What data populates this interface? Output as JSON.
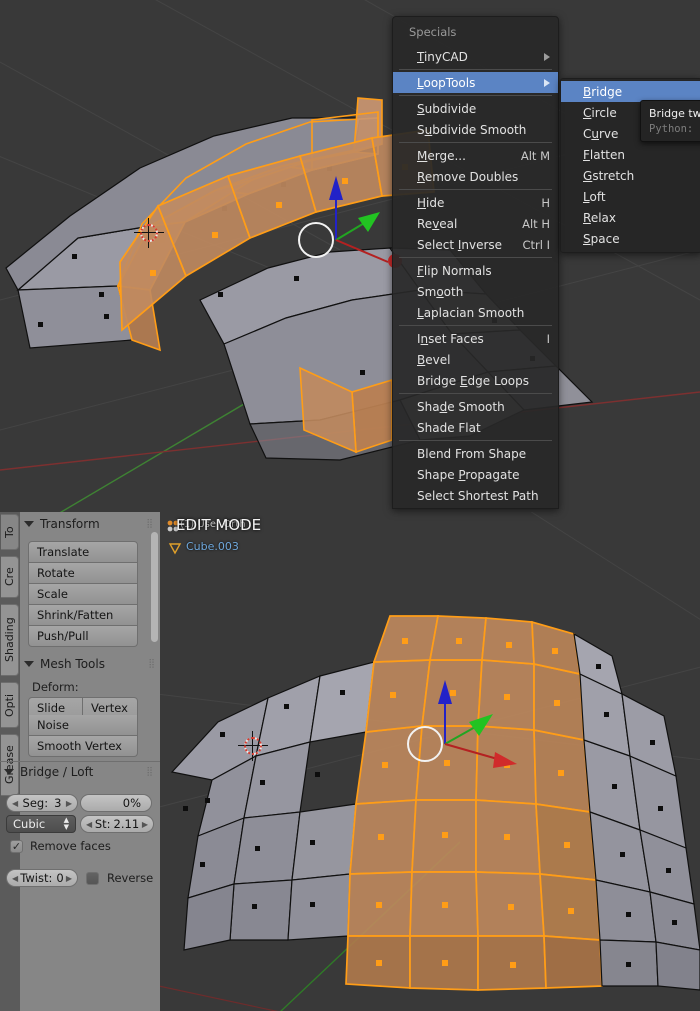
{
  "app": "Blender",
  "viewports": {
    "top": {
      "background": "#393939"
    },
    "bottom": {
      "background": "#393939",
      "view_info": "(1) User Orth",
      "mode_label": "EDIT MODE",
      "object_name": "Cube.003"
    }
  },
  "colors": {
    "viewport_bg": "#393939",
    "face_selected": "#c08a5e",
    "face_unselected": "#9a9aa4",
    "edge_selected": "#ff9d17",
    "edge_unselected": "#101010",
    "menu_highlight": "#5b84c4",
    "panel_bg": "#868686",
    "axis_x": "#d02b2b",
    "axis_y": "#22c322",
    "axis_z": "#2222c8",
    "object_name_color": "#6fa8dc"
  },
  "specials_menu": {
    "title": "Specials",
    "groups": [
      [
        {
          "label": "TinyCAD",
          "accel": "T",
          "submenu": true,
          "selected": false,
          "shortcut": ""
        }
      ],
      [
        {
          "label": "LoopTools",
          "accel": "L",
          "submenu": true,
          "selected": true,
          "shortcut": ""
        }
      ],
      [
        {
          "label": "Subdivide",
          "accel": "S",
          "submenu": false,
          "selected": false,
          "shortcut": ""
        },
        {
          "label": "Subdivide Smooth",
          "accel": "u",
          "submenu": false,
          "selected": false,
          "shortcut": ""
        }
      ],
      [
        {
          "label": "Merge...",
          "accel": "M",
          "submenu": false,
          "selected": false,
          "shortcut": "Alt M"
        },
        {
          "label": "Remove Doubles",
          "accel": "R",
          "submenu": false,
          "selected": false,
          "shortcut": ""
        }
      ],
      [
        {
          "label": "Hide",
          "accel": "H",
          "submenu": false,
          "selected": false,
          "shortcut": "H"
        },
        {
          "label": "Reveal",
          "accel": "v",
          "submenu": false,
          "selected": false,
          "shortcut": "Alt H"
        },
        {
          "label": "Select Inverse",
          "accel": "I",
          "submenu": false,
          "selected": false,
          "shortcut": "Ctrl I"
        }
      ],
      [
        {
          "label": "Flip Normals",
          "accel": "F",
          "submenu": false,
          "selected": false,
          "shortcut": ""
        },
        {
          "label": "Smooth",
          "accel": "o",
          "submenu": false,
          "selected": false,
          "shortcut": ""
        },
        {
          "label": "Laplacian Smooth",
          "accel": "L",
          "submenu": false,
          "selected": false,
          "shortcut": ""
        }
      ],
      [
        {
          "label": "Inset Faces",
          "accel": "n",
          "submenu": false,
          "selected": false,
          "shortcut": "I"
        },
        {
          "label": "Bevel",
          "accel": "B",
          "submenu": false,
          "selected": false,
          "shortcut": ""
        },
        {
          "label": "Bridge Edge Loops",
          "accel": "E",
          "submenu": false,
          "selected": false,
          "shortcut": ""
        }
      ],
      [
        {
          "label": "Shade Smooth",
          "accel": "d",
          "submenu": false,
          "selected": false,
          "shortcut": ""
        },
        {
          "label": "Shade Flat",
          "accel": "",
          "submenu": false,
          "selected": false,
          "shortcut": ""
        }
      ],
      [
        {
          "label": "Blend From Shape",
          "accel": "",
          "submenu": false,
          "selected": false,
          "shortcut": ""
        },
        {
          "label": "Shape Propagate",
          "accel": "P",
          "submenu": false,
          "selected": false,
          "shortcut": ""
        },
        {
          "label": "Select Shortest Path",
          "accel": "",
          "submenu": false,
          "selected": false,
          "shortcut": ""
        }
      ]
    ]
  },
  "looptools_submenu": {
    "items": [
      {
        "label": "Bridge",
        "accel": "B",
        "selected": true
      },
      {
        "label": "Circle",
        "accel": "C",
        "selected": false
      },
      {
        "label": "Curve",
        "accel": "u",
        "selected": false
      },
      {
        "label": "Flatten",
        "accel": "F",
        "selected": false
      },
      {
        "label": "Gstretch",
        "accel": "G",
        "selected": false
      },
      {
        "label": "Loft",
        "accel": "L",
        "selected": false
      },
      {
        "label": "Relax",
        "accel": "R",
        "selected": false
      },
      {
        "label": "Space",
        "accel": "S",
        "selected": false
      }
    ]
  },
  "tooltip": {
    "main": "Bridge tw",
    "sub": "Python:"
  },
  "tools_panel": {
    "tabs": [
      {
        "label": "To",
        "active": true
      },
      {
        "label": "Cre",
        "active": false
      },
      {
        "label": "Shading",
        "active": false
      },
      {
        "label": "Opti",
        "active": false
      },
      {
        "label": "Grease",
        "active": false
      }
    ],
    "transform": {
      "title": "Transform",
      "buttons": [
        "Translate",
        "Rotate",
        "Scale",
        "Shrink/Fatten",
        "Push/Pull"
      ]
    },
    "mesh_tools": {
      "title": "Mesh Tools",
      "deform_label": "Deform:",
      "row_buttons": [
        "Slide Ed",
        "Vertex"
      ],
      "buttons": [
        "Noise",
        "Smooth Vertex"
      ]
    },
    "bridge_loft": {
      "title": "Bridge / Loft",
      "segments_label": "Seg:",
      "segments_value": "3",
      "percent_value": "0%",
      "interpolation": "Cubic",
      "strength_label": "St:",
      "strength_value": "2.11",
      "remove_faces_label": "Remove faces",
      "remove_faces_checked": true,
      "twist_label": "Twist:",
      "twist_value": "0",
      "reverse_label": "Reverse",
      "reverse_checked": false
    }
  }
}
